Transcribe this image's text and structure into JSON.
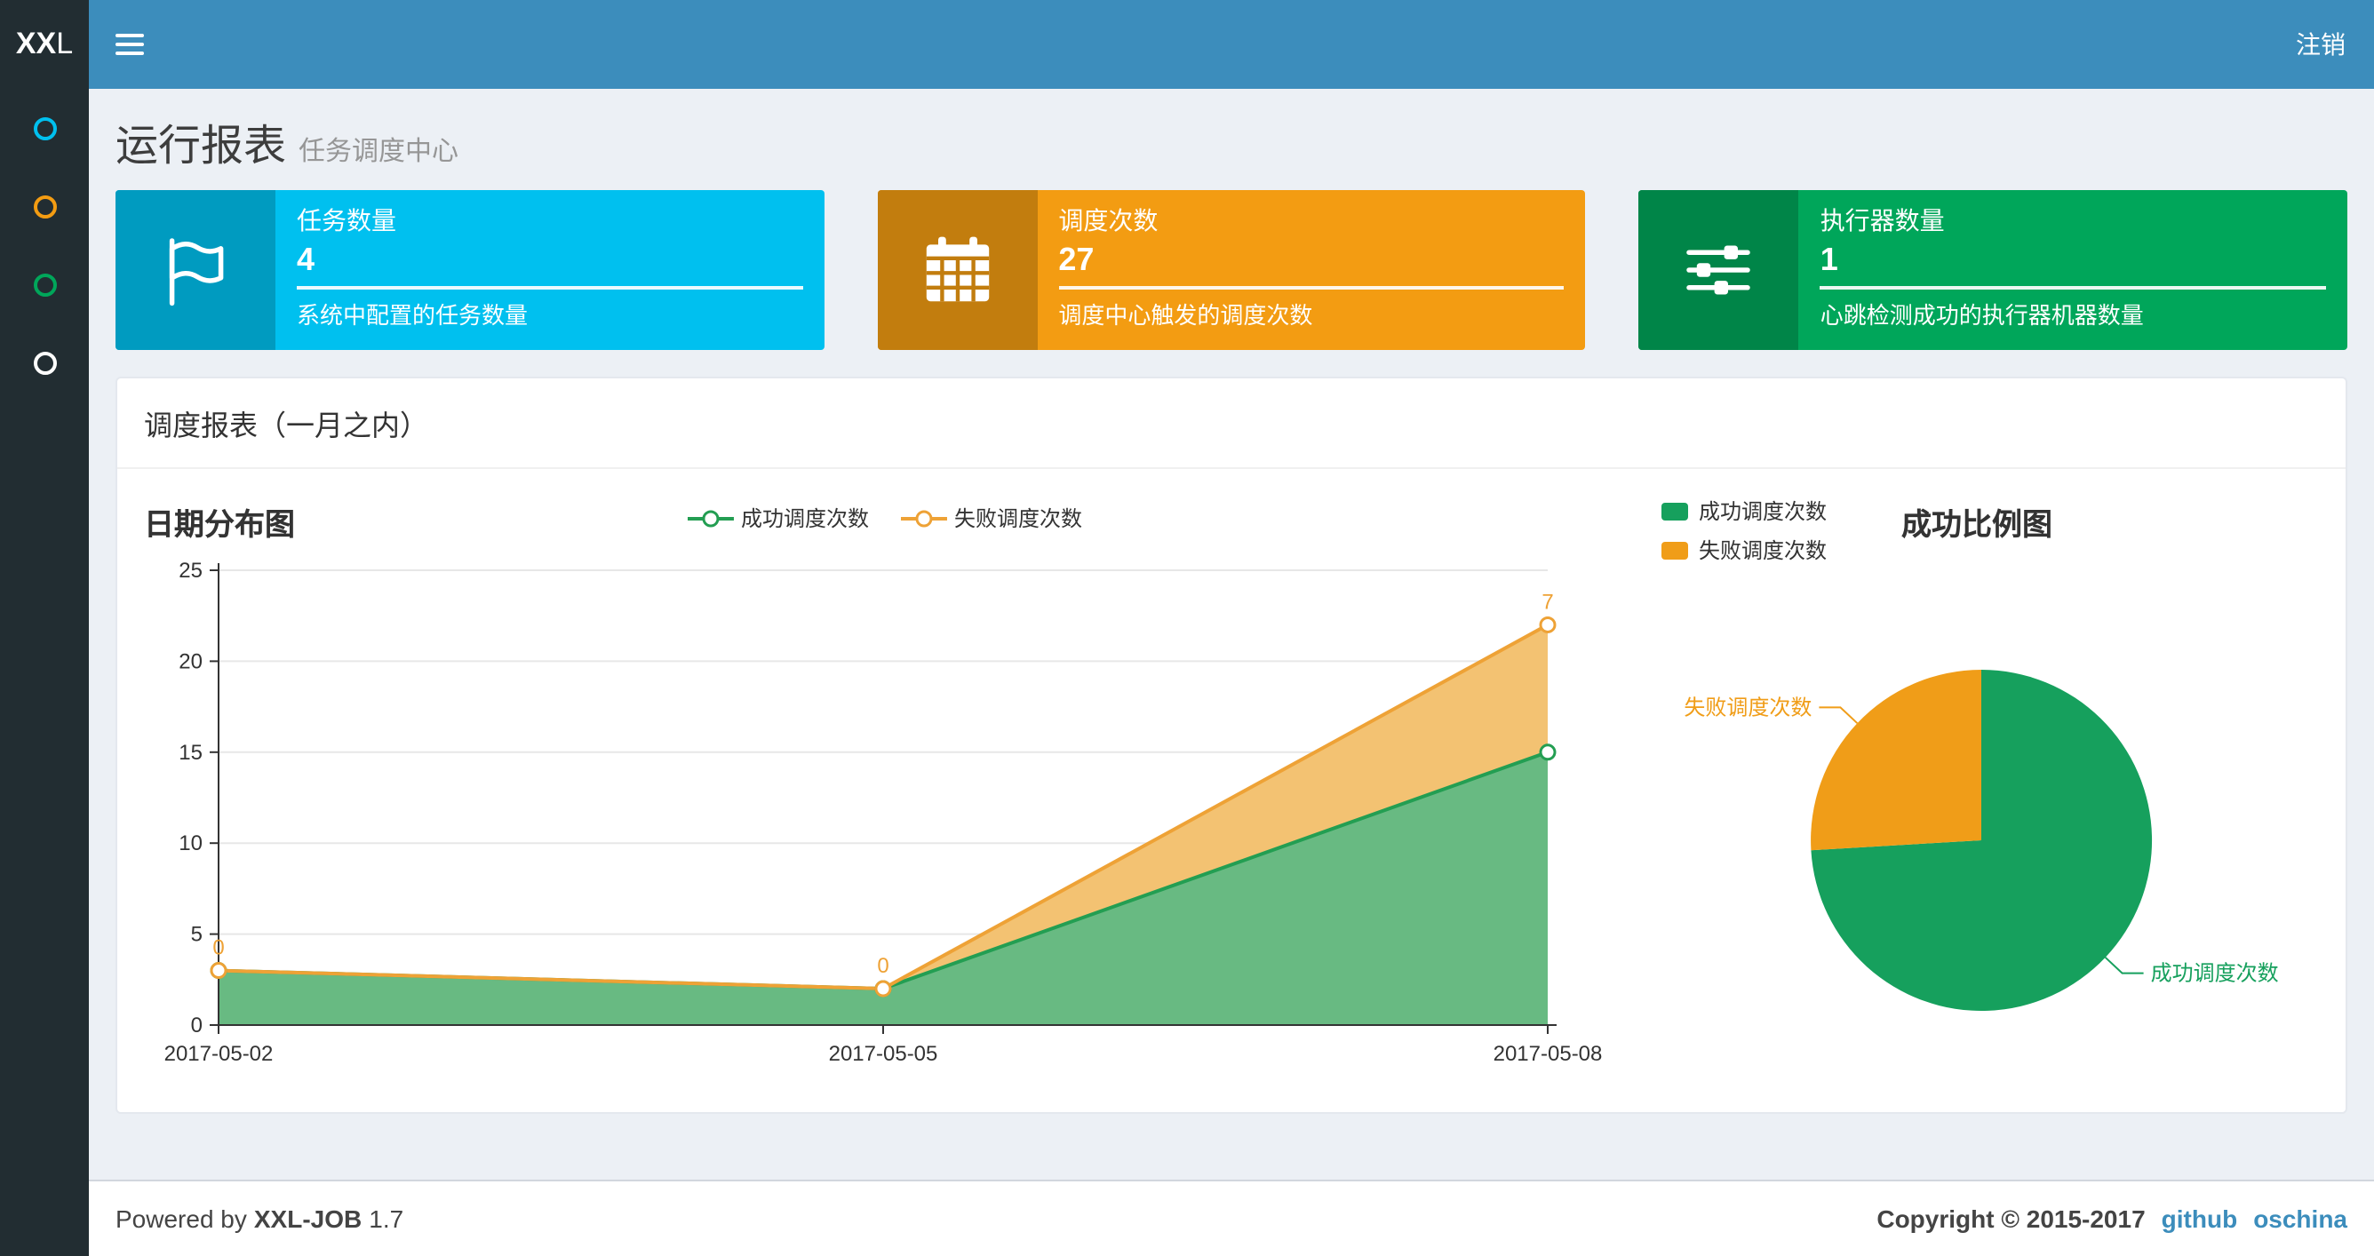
{
  "navbar": {
    "logo_bold": "XX",
    "logo_light": "L",
    "logout": "注销"
  },
  "sidebar": {
    "items": [
      {
        "icon": "circle-icon",
        "color": "#00c0ef"
      },
      {
        "icon": "circle-icon",
        "color": "#f39c12"
      },
      {
        "icon": "circle-icon",
        "color": "#00a65a"
      },
      {
        "icon": "circle-icon",
        "color": "#ffffff"
      }
    ]
  },
  "header": {
    "title": "运行报表",
    "subtitle": "任务调度中心"
  },
  "info_boxes": [
    {
      "title": "任务数量",
      "value": "4",
      "desc": "系统中配置的任务数量",
      "color": "#00c0ef",
      "icon_color": "#009bc0",
      "icon": "flag-icon"
    },
    {
      "title": "调度次数",
      "value": "27",
      "desc": "调度中心触发的调度次数",
      "color": "#f39c12",
      "icon_color": "#c27d0e",
      "icon": "calendar-icon"
    },
    {
      "title": "执行器数量",
      "value": "1",
      "desc": "心跳检测成功的执行器机器数量",
      "color": "#00a65a",
      "icon_color": "#008548",
      "icon": "sliders-icon"
    }
  ],
  "panel": {
    "title": "调度报表（一月之内）"
  },
  "chart_data": [
    {
      "type": "area",
      "title": "日期分布图",
      "stacked": true,
      "x": [
        "2017-05-02",
        "2017-05-05",
        "2017-05-08"
      ],
      "series": [
        {
          "name": "成功调度次数",
          "values": [
            3,
            2,
            15
          ],
          "color": "#239e52",
          "fill": "#68ba82",
          "show_labels": false
        },
        {
          "name": "失败调度次数",
          "values": [
            0,
            0,
            7
          ],
          "color": "#eea236",
          "fill": "#f3c272",
          "show_labels": true
        }
      ],
      "ylim": [
        0,
        25
      ],
      "yticks": [
        0,
        5,
        10,
        15,
        20,
        25
      ],
      "legend": [
        "成功调度次数",
        "失败调度次数"
      ],
      "legend_position": "top",
      "grid": true
    },
    {
      "type": "pie",
      "title": "成功比例图",
      "slices": [
        {
          "name": "成功调度次数",
          "value": 20,
          "color": "#16a05d"
        },
        {
          "name": "失败调度次数",
          "value": 7,
          "color": "#f09d18"
        }
      ],
      "legend": [
        "成功调度次数",
        "失败调度次数"
      ],
      "legend_position": "top-left"
    }
  ],
  "footer": {
    "powered_by": "Powered by",
    "app_name": "XXL-JOB",
    "version": "1.7",
    "copyright": "Copyright © 2015-2017",
    "links": [
      {
        "label": "github"
      },
      {
        "label": "oschina"
      }
    ]
  }
}
